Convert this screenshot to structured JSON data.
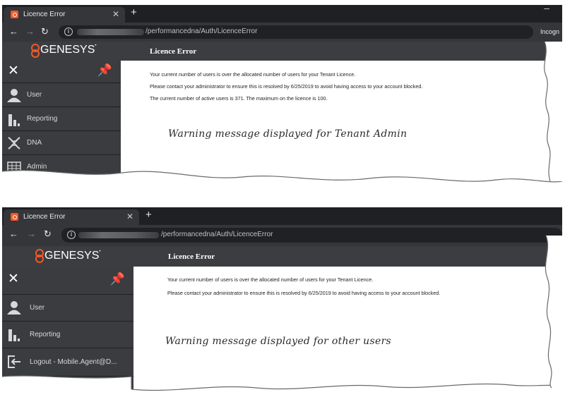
{
  "panels": [
    {
      "tab": {
        "title": "Licence Error"
      },
      "address": {
        "url": "/performancedna/Auth/LicenceError",
        "incognito": "Incogn"
      },
      "app": {
        "brand": "GENESYS",
        "heading": "Licence Error"
      },
      "sidebar": {
        "items": [
          {
            "label": "User",
            "icon": "user-icon"
          },
          {
            "label": "Reporting",
            "icon": "bar-chart-icon"
          },
          {
            "label": "DNA",
            "icon": "dna-icon"
          },
          {
            "label": "Admin",
            "icon": "admin-grid-icon"
          }
        ]
      },
      "messages": [
        "Your current number of users is over the allocated number of users for your Tenant Licence.",
        "Please contact your administrator to ensure this is resolved by 6/25/2019 to avoid having access to your account blocked.",
        "The current number of active users is 371. The maximum on the licence is 100."
      ],
      "annotation": "Warning message displayed for Tenant Admin"
    },
    {
      "tab": {
        "title": "Licence Error"
      },
      "address": {
        "url": "/performancedna/Auth/LicenceError"
      },
      "app": {
        "brand": "GENESYS",
        "heading": "Licence Error"
      },
      "sidebar": {
        "items": [
          {
            "label": "User",
            "icon": "user-icon"
          },
          {
            "label": "Reporting",
            "icon": "bar-chart-icon"
          },
          {
            "label": "Logout - Mobile.Agent@D...",
            "icon": "logout-icon"
          }
        ]
      },
      "messages": [
        "Your current number of users is over the allocated number of users for your Tenant Licence.",
        "Please contact your administrator to ensure this is resolved by 6/25/2019 to avoid having access to your account blocked."
      ],
      "annotation": "Warning message displayed for other users"
    }
  ],
  "colors": {
    "brand_accent": "#f05a28",
    "tab_bar": "#1f2023",
    "toolbar": "#35363a",
    "app_header": "#3c3d40",
    "sidebar": "#3b3c40"
  }
}
